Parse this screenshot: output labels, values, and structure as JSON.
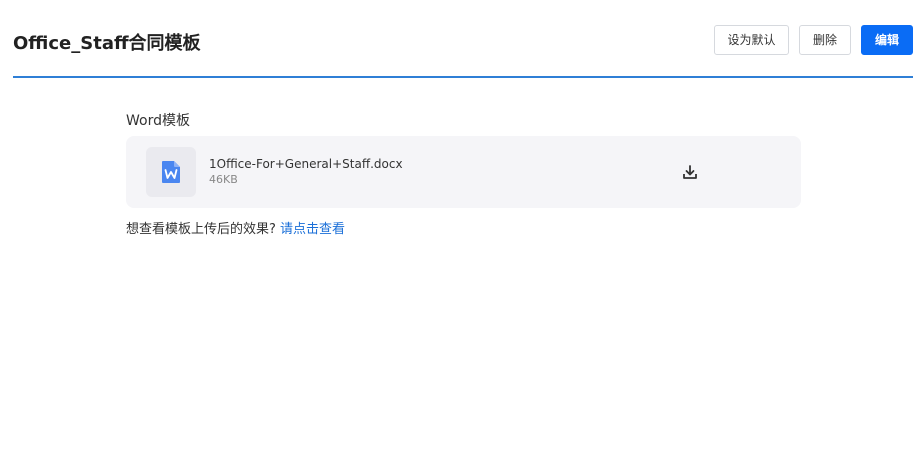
{
  "header": {
    "title": "Office_Staff合同模板",
    "set_default_label": "设为默认",
    "delete_label": "删除",
    "edit_label": "编辑"
  },
  "template": {
    "section_label": "Word模板",
    "file": {
      "name": "1Office-For+General+Staff.docx",
      "size": "46KB",
      "icon": "word-file-icon"
    },
    "download_icon": "download-icon"
  },
  "hint": {
    "text": "想查看模板上传后的效果?",
    "link": "请点击查看"
  },
  "colors": {
    "accent": "#0a6cf5",
    "header_rule": "#2f7fd6",
    "link": "#1a6fd8",
    "word_icon": "#4a86f0"
  }
}
